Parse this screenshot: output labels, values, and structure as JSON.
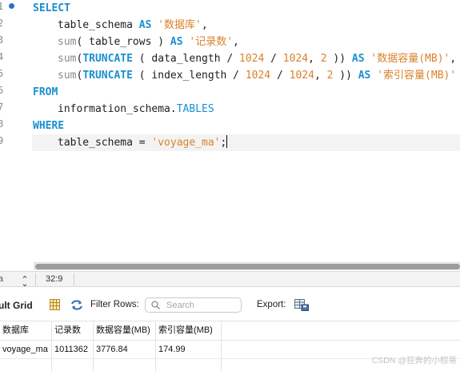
{
  "editor": {
    "line_numbers": [
      "1",
      "2",
      "3",
      "4",
      "5",
      "6",
      "7",
      "8",
      "9"
    ],
    "lines": {
      "l1": {
        "kw_select": "SELECT"
      },
      "l2": {
        "col": "table_schema",
        "as": "AS",
        "alias": "'数据库'",
        "comma": ","
      },
      "l3": {
        "fn": "sum",
        "open": "( ",
        "col": "table_rows",
        "close": " ) ",
        "as": "AS",
        "alias": "'记录数'",
        "comma": ","
      },
      "l4": {
        "fn": "sum",
        "paren": "(",
        "kw": "TRUNCATE",
        "open": " ( ",
        "col": "data_length",
        "div1": " / ",
        "n1": "1024",
        "div2": " / ",
        "n2": "1024",
        "comma": ", ",
        "n3": "2",
        "close": " )) ",
        "as": "AS",
        "alias": "'数据容量(MB)'",
        "end": ","
      },
      "l5": {
        "fn": "sum",
        "paren": "(",
        "kw": "TRUNCATE",
        "open": " ( ",
        "col": "index_length",
        "div1": " / ",
        "n1": "1024",
        "div2": " / ",
        "n2": "1024",
        "comma": ", ",
        "n3": "2",
        "close": " )) ",
        "as": "AS",
        "alias": "'索引容量(MB)'"
      },
      "l6": {
        "kw_from": "FROM"
      },
      "l7": {
        "schema": "information_schema.",
        "table": "TABLES"
      },
      "l8": {
        "kw_where": "WHERE"
      },
      "l9": {
        "col": "table_schema",
        "eq": " = ",
        "value": "'voyage_ma'",
        "semi": ";"
      }
    }
  },
  "status_bar": {
    "left_text": "a",
    "cursor_position": "32:9"
  },
  "result_toolbar": {
    "title": "ult Grid",
    "filter_label": "Filter Rows:",
    "search_placeholder": "Search",
    "export_label": "Export:"
  },
  "result_grid": {
    "columns": [
      "数据库",
      "记录数",
      "数据容量(MB)",
      "索引容量(MB)"
    ],
    "rows": [
      [
        "voyage_ma",
        "1011362",
        "3776.84",
        "174.99"
      ]
    ]
  },
  "watermark": "CSDN @狂奔的小棕蒂",
  "colors": {
    "keyword": "#1a8fd0",
    "function": "#8a8a8a",
    "literal": "#d9822b",
    "breakpoint": "#2b6fd0"
  },
  "icons": {
    "grid": "grid-view-icon",
    "refresh": "refresh-icon",
    "search": "search-icon",
    "export": "export-icon",
    "stepper": "up-down-stepper-icon"
  }
}
